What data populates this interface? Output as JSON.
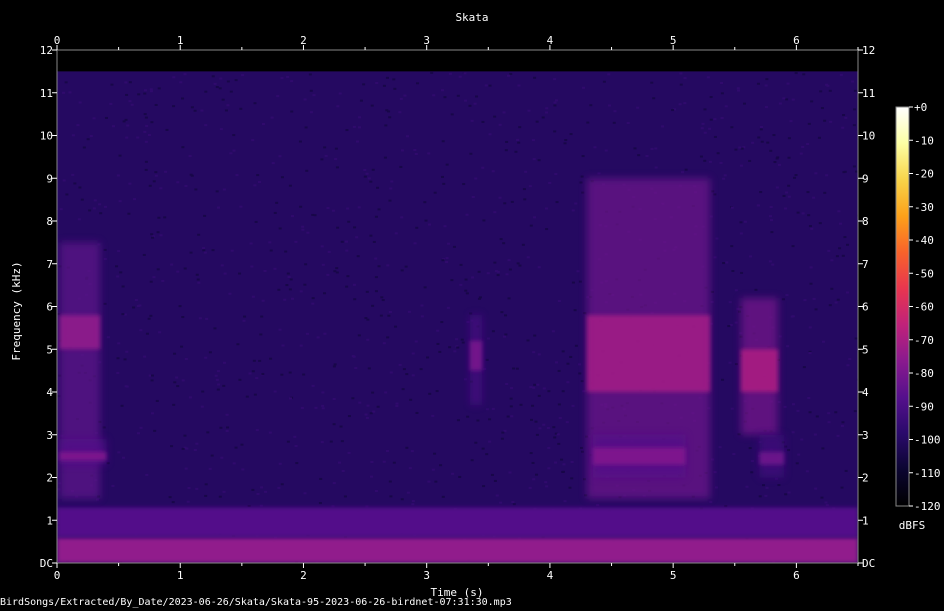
{
  "chart_data": {
    "type": "heatmap",
    "title": "Skata",
    "xlabel": "Time (s)",
    "ylabel": "Frequency (kHz)",
    "xlim": [
      0,
      6.5
    ],
    "ylim": [
      0,
      12
    ],
    "x_ticks": [
      0,
      1,
      2,
      3,
      4,
      5,
      6
    ],
    "y_ticks": [
      "DC",
      "1",
      "2",
      "3",
      "4",
      "5",
      "6",
      "7",
      "8",
      "9",
      "10",
      "11",
      "12"
    ],
    "colorbar": {
      "label": "dBFS",
      "ticks": [
        "+0",
        "-10",
        "-20",
        "-30",
        "-40",
        "-50",
        "-60",
        "-70",
        "-80",
        "-90",
        "-100",
        "-110",
        "-120"
      ],
      "range": [
        -120,
        0
      ],
      "colors": [
        "#000000",
        "#0b0530",
        "#2a0a6b",
        "#55108c",
        "#8a1a8e",
        "#c0227a",
        "#e8364f",
        "#f8632a",
        "#fca11a",
        "#f8d44a",
        "#fcffa4",
        "#ffffff"
      ]
    },
    "background_level_dbfs": -100,
    "low_freq_band": [
      {
        "freq_min_khz": 0,
        "freq_max_khz": 0.6,
        "level_dbfs": -75
      },
      {
        "freq_min_khz": 0.6,
        "freq_max_khz": 1.3,
        "level_dbfs": -88
      }
    ],
    "energy_cutoff_khz": 11.5,
    "events": [
      {
        "t_start": 0.02,
        "t_end": 0.35,
        "f_min": 1.5,
        "f_max": 7.5,
        "peak_f_min": 5.0,
        "peak_f_max": 5.8,
        "level_dbfs": -75
      },
      {
        "t_start": 0.02,
        "t_end": 0.4,
        "f_min": 2.3,
        "f_max": 2.9,
        "peak_f_min": 2.4,
        "peak_f_max": 2.6,
        "level_dbfs": -78
      },
      {
        "t_start": 3.35,
        "t_end": 3.45,
        "f_min": 3.7,
        "f_max": 5.8,
        "peak_f_min": 4.5,
        "peak_f_max": 5.2,
        "level_dbfs": -80
      },
      {
        "t_start": 4.3,
        "t_end": 5.3,
        "f_min": 1.5,
        "f_max": 9.0,
        "peak_f_min": 4.0,
        "peak_f_max": 5.8,
        "level_dbfs": -72
      },
      {
        "t_start": 4.35,
        "t_end": 5.1,
        "f_min": 2.0,
        "f_max": 3.0,
        "peak_f_min": 2.3,
        "peak_f_max": 2.7,
        "level_dbfs": -78
      },
      {
        "t_start": 5.55,
        "t_end": 5.85,
        "f_min": 3.0,
        "f_max": 6.2,
        "peak_f_min": 4.0,
        "peak_f_max": 5.0,
        "level_dbfs": -70
      },
      {
        "t_start": 5.7,
        "t_end": 5.9,
        "f_min": 2.0,
        "f_max": 3.0,
        "peak_f_min": 2.3,
        "peak_f_max": 2.6,
        "level_dbfs": -82
      }
    ]
  },
  "footer": {
    "path": "BirdSongs/Extracted/By_Date/2023-06-26/Skata/Skata-95-2023-06-26-birdnet-07:31:30.mp3"
  }
}
